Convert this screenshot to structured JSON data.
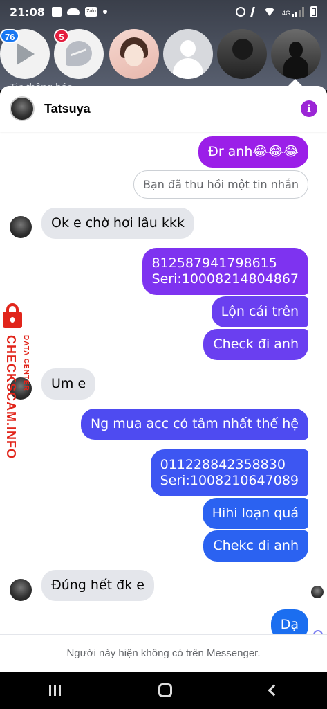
{
  "status_bar": {
    "time": "21:08",
    "notification_icons": [
      "image-icon",
      "cloud-icon",
      "zalo-icon",
      "dot-icon"
    ],
    "zalo_label": "Zalo",
    "system_icons": [
      "alarm-icon",
      "mute-icon",
      "wifi-icon",
      "4g-signal-icon",
      "battery-icon"
    ],
    "network_label": "4G"
  },
  "chat_heads": {
    "badges": {
      "video": "76",
      "messenger": "5"
    },
    "background_text": "Tin thông báo"
  },
  "chat": {
    "contact_name": "Tatsuya",
    "info_icon": "i",
    "messages": [
      {
        "dir": "out",
        "text": "Đr anh😂😂😂",
        "color": "#9b1fe8"
      },
      {
        "dir": "system",
        "text": "Bạn đã thu hồi một tin nhắn"
      },
      {
        "dir": "in",
        "text": "Ok e chờ hơi lâu kkk"
      },
      {
        "dir": "out",
        "text_line1": "812587941798615",
        "text_line2": "Seri:10008214804867",
        "color": "#7e33f0"
      },
      {
        "dir": "out",
        "text": "Lộn cái trên",
        "color": "#6a3ff0"
      },
      {
        "dir": "out",
        "text": "Check đi anh",
        "color": "#6a3ff0"
      },
      {
        "dir": "in",
        "text": "Um e"
      },
      {
        "dir": "out",
        "text": "Ng mua acc có tâm nhất thế hệ",
        "color": "#4e4bf1"
      },
      {
        "dir": "out",
        "text_line1": "011228842358830",
        "text_line2": "Seri:1008210647089",
        "color": "#3d56f2"
      },
      {
        "dir": "out",
        "text": "Hihi loạn quá",
        "color": "#2b62f1"
      },
      {
        "dir": "out",
        "text": "Chekc đi anh",
        "color": "#2b62f1"
      },
      {
        "dir": "in",
        "text": "Đúng hết đk e"
      },
      {
        "dir": "out",
        "text": "Dạ",
        "color": "#1b6ef0"
      }
    ],
    "footer_notice": "Người này hiện không có trên Messenger."
  },
  "watermark": {
    "main_text": "CHECKSCAM.INFO",
    "sub_text": "DATA CENTER",
    "color": "#e1251b"
  },
  "nav_bar": {
    "buttons": [
      "recent-apps-button",
      "home-button",
      "back-button"
    ]
  }
}
